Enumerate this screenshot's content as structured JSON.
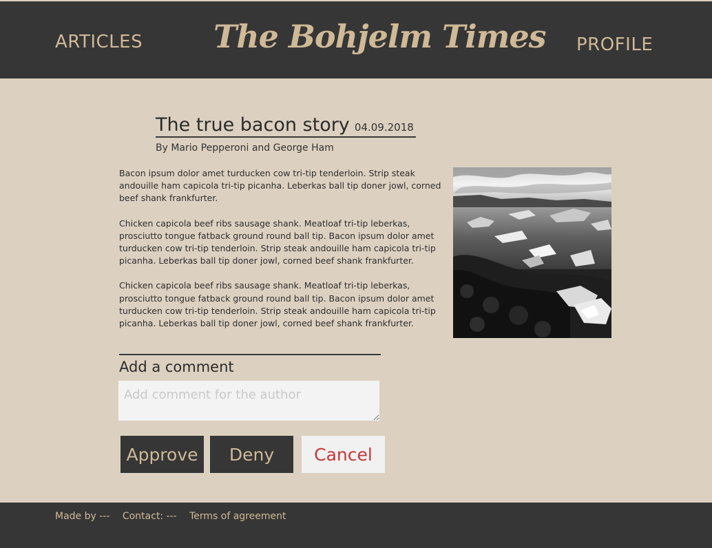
{
  "header": {
    "nav_articles": "ARTICLES",
    "site_title": "The Bohjelm Times",
    "nav_profile": "PROFILE"
  },
  "article": {
    "title": "The true bacon story",
    "date": "04.09.2018",
    "byline": "By Mario Pepperoni and George Ham",
    "paragraphs": [
      "Bacon ipsum dolor amet turducken cow tri-tip tenderloin. Strip steak andouille ham capicola tri-tip picanha. Leberkas ball tip doner jowl, corned beef shank frankfurter.",
      "Chicken capicola beef ribs sausage shank. Meatloaf tri-tip leberkas, prosciutto tongue fatback ground round ball tip. Bacon ipsum dolor amet turducken cow tri-tip tenderloin. Strip steak andouille ham capicola tri-tip picanha. Leberkas ball tip doner jowl, corned beef shank frankfurter.",
      "Chicken capicola beef ribs sausage shank. Meatloaf tri-tip leberkas, prosciutto tongue fatback ground round ball tip. Bacon ipsum dolor amet turducken cow tri-tip tenderloin. Strip steak andouille ham capicola tri-tip picanha. Leberkas ball tip doner jowl, corned beef shank frankfurter."
    ]
  },
  "comment": {
    "label": "Add a comment",
    "placeholder": "Add comment for the author",
    "value": ""
  },
  "actions": {
    "approve": "Approve",
    "deny": "Deny",
    "cancel": "Cancel"
  },
  "footer": {
    "made_by": "Made by ---",
    "contact": "Contact: ---",
    "terms": "Terms of agreement"
  },
  "colors": {
    "background": "#dcd0c0",
    "dark": "#363636",
    "accent": "#cfb997",
    "cancel_text": "#c4383a"
  }
}
